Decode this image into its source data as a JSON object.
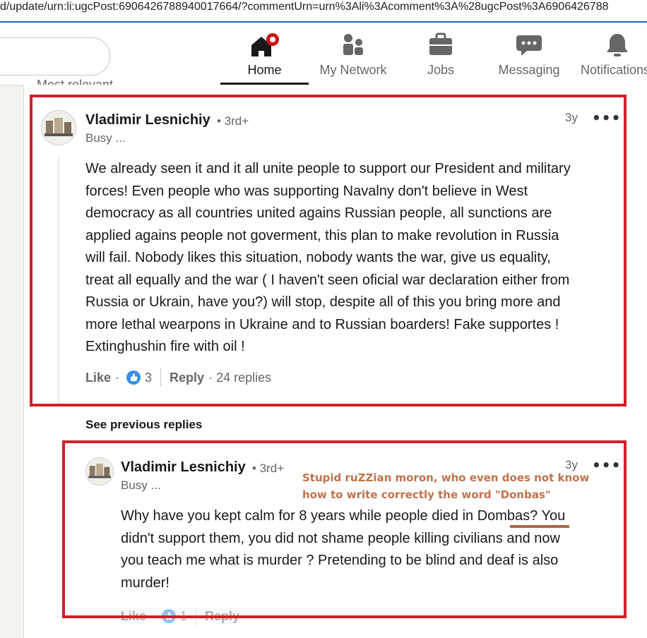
{
  "browser": {
    "url": "d/update/urn:li:ugcPost:6906426788940017664/?commentUrn=urn%3Ali%3Acomment%3A%28ugcPost%3A6906426788"
  },
  "nav": {
    "items": [
      {
        "label": "Home",
        "icon": "home-icon"
      },
      {
        "label": "My Network",
        "icon": "network-icon"
      },
      {
        "label": "Jobs",
        "icon": "briefcase-icon"
      },
      {
        "label": "Messaging",
        "icon": "messaging-icon"
      },
      {
        "label": "Notifications",
        "icon": "bell-icon"
      }
    ],
    "active": "Home"
  },
  "section_label": "Most relevant",
  "comment1": {
    "author": "Vladimir Lesnichiy",
    "degree": "• 3rd+",
    "headline": "Busy ...",
    "time": "3y",
    "more": "•••",
    "lines": [
      "We already seen it and it all unite people to support our President and military",
      "forces! Even people who was supporting Navalny don't believe in West",
      "democracy as all countries united agains Russian people, all sunctions are",
      "applied agains people not goverment, this plan to make revolution in Russia",
      "will fail. Nobody likes this situation, nobody wants the war, give us equality,",
      "treat all equally and the war ( I haven't seen oficial war declaration either from",
      "Russia or Ukrain, have you?) will stop, despite all of this you bring more and",
      "more lethal wearpons in Ukraine and to Russian boarders! Fake supportes !",
      "Extinghushin fire with oil !"
    ],
    "like_label": "Like",
    "dot": "·",
    "like_count": "3",
    "reply_label": "Reply",
    "replies_text": "· 24 replies"
  },
  "see_previous": "See previous replies",
  "comment2": {
    "author": "Vladimir Lesnichiy",
    "degree": "• 3rd+",
    "headline": "Busy ...",
    "time": "3y",
    "more": "•••",
    "lines": [
      "Why have you kept calm for 8 years while people died in Dombas? You",
      "didn't support them, you did not shame people killing civilians and now",
      "you teach me what is murder ? Pretending to be blind and deaf is also",
      "murder!"
    ],
    "like_label": "Like",
    "dot": "·",
    "like_count": "1",
    "reply_label": "Reply"
  },
  "annotation": {
    "line1": "Stupid ruZZian moron, who even does not know",
    "line2": "how to write correctly the word \"Donbas\"",
    "color": "#c0724a"
  },
  "colors": {
    "highlight_box": "#d21f2c",
    "like_blue": "#378fe9",
    "active_tab": "#191919"
  }
}
